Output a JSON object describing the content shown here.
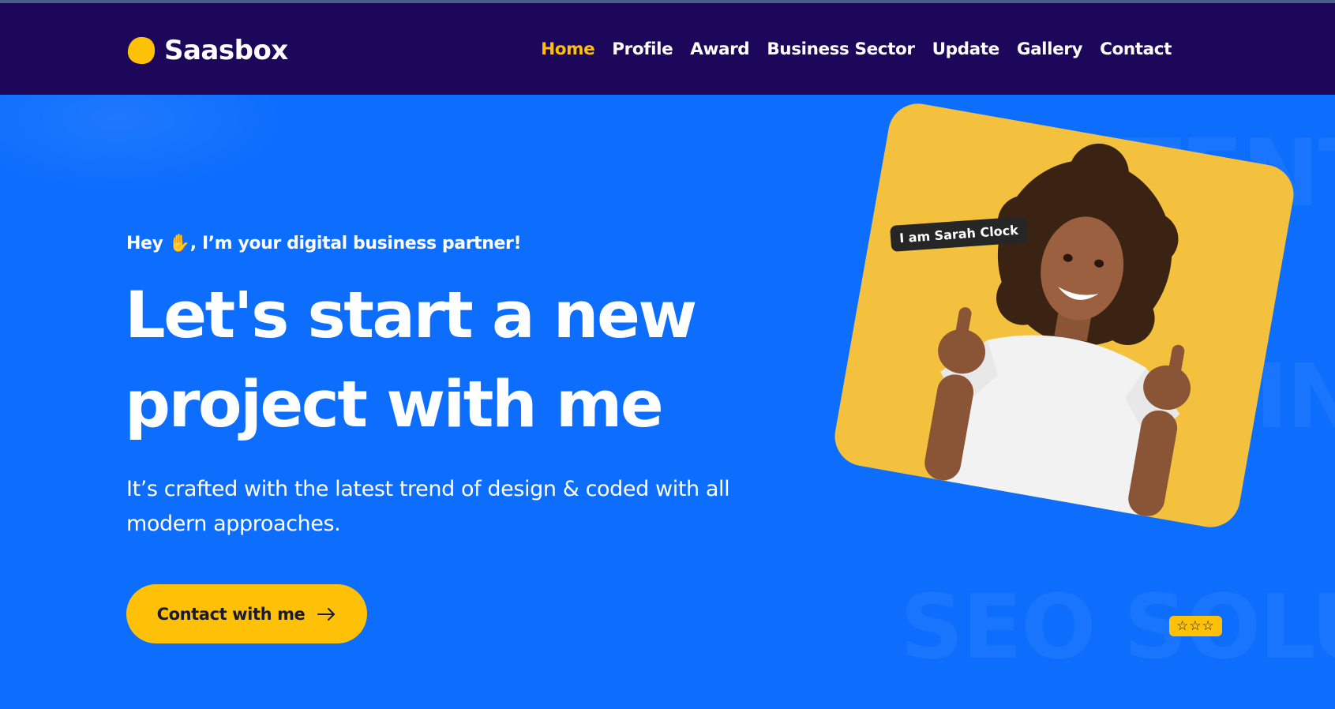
{
  "brand": {
    "name": "Saasbox",
    "logo_icon": "leaf-blob-icon",
    "logo_color": "#ffc107"
  },
  "nav": {
    "items": [
      {
        "label": "Home",
        "active": true
      },
      {
        "label": "Profile",
        "active": false
      },
      {
        "label": "Award",
        "active": false
      },
      {
        "label": "Business Sector",
        "active": false
      },
      {
        "label": "Update",
        "active": false
      },
      {
        "label": "Gallery",
        "active": false
      },
      {
        "label": "Contact",
        "active": false
      }
    ]
  },
  "hero": {
    "eyebrow": "Hey ✋, I’m your digital business partner!",
    "headline_line1": "Let's start a new",
    "headline_line2": "project with me",
    "subtext": "It’s crafted with the latest trend of design & coded with all modern approaches.",
    "cta_label": "Contact with me",
    "cta_icon": "arrow-right-icon",
    "background_words": [
      "CONTENT",
      "IN",
      "SEO SOLU"
    ]
  },
  "profile_card": {
    "name_badge": "I am Sarah Clock",
    "rating_stars": "☆☆☆",
    "rating_value": "0 of 3 stars filled"
  },
  "colors": {
    "navbar_bg": "#1d075a",
    "hero_bg": "#0d6efd",
    "accent": "#ffc107",
    "photo_bg": "#f3c13e"
  }
}
